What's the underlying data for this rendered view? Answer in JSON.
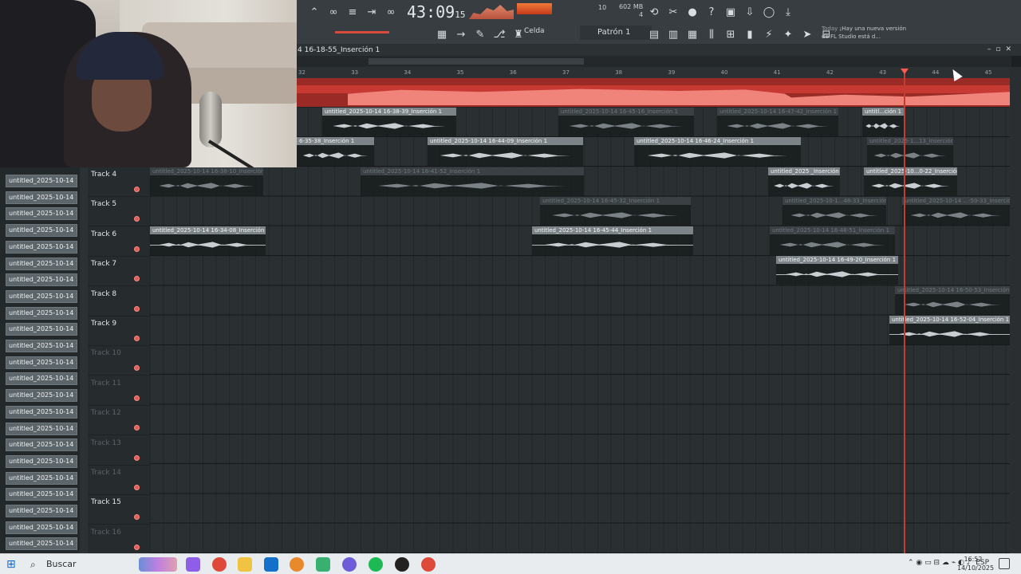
{
  "toolbar": {
    "time_main": "43:09",
    "time_sub": "15",
    "tempo_value": "10",
    "memory": "602 MB",
    "memory_sub": "4",
    "snap_label": "Celda",
    "pattern_label": "Patrón 1",
    "news_today": "Today",
    "news_text": "¡Hay una nueva versión de FL Studio está d..."
  },
  "breadcrumb": {
    "title": "4 16-18-55_Inserción 1"
  },
  "ruler": {
    "bars": [
      "32",
      "33",
      "34",
      "35",
      "36",
      "37",
      "38",
      "39",
      "40",
      "41",
      "42",
      "43",
      "44",
      "45"
    ]
  },
  "picker": {
    "items": [
      "untitled_2025-10-14 16-...",
      "untitled_2025-10-14 16-...",
      "untitled_2025-10-14 16-...",
      "untitled_2025-10-14 16-...",
      "untitled_2025-10-14 16-...",
      "untitled_2025-10-14 16-...",
      "untitled_2025-10-14 16-...",
      "untitled_2025-10-14 16-...",
      "untitled_2025-10-14 16-...",
      "untitled_2025-10-14 16-...",
      "untitled_2025-10-14 16-...",
      "untitled_2025-10-14 16-...",
      "untitled_2025-10-14 16-...",
      "untitled_2025-10-14 16-...",
      "untitled_2025-10-14 16-...",
      "untitled_2025-10-14 16-...",
      "untitled_2025-10-14 16-...",
      "untitled_2025-10-14 16-...",
      "untitled_2025-10-14 16-...",
      "untitled_2025-10-14 16-...",
      "untitled_2025-10-14 16-...",
      "untitled_2025-10-14 16-...",
      "untitled_2025-10-14 16-..."
    ]
  },
  "tracks": [
    "Track 4",
    "Track 5",
    "Track 6",
    "Track 7",
    "Track 8",
    "Track 9",
    "Track 10",
    "Track 11",
    "Track 12",
    "Track 13",
    "Track 14",
    "Track 15",
    "Track 16"
  ],
  "clips": {
    "r1a": "untitled_2025-10-14 16-38-39_Inserción 1",
    "r1b": "untitled_2025-10-14 16-45-16_Inserción 1",
    "r1c": "untitled_2025-10-14 16-47-42_Inserción 1",
    "r1d": "untitl...ción 1",
    "r2a": "6-35-38_Inserción 1",
    "r2b": "untitled_2025-10-14 16-44-09_Inserción 1",
    "r2c": "untitled_2025-10-14 16-46-24_Inserción 1",
    "r2d": "untitled_2025-1...13_Inserción 1",
    "t4a": "untitled_2025-10-14 16-38-10_Inserción 1",
    "t4b": "untitled_2025-10-14 16-41-52_Inserción 1",
    "t4c": "untitled_2025 _Inserción 1",
    "t4d": "untitled_2025-10...0-22_Inserción 1",
    "t5a": "untitled_2025-10-14 16-45-32_Inserción 1",
    "t5b": "untitled_2025-10-1...48-33_Inserción 1",
    "t5c": "untitled_2025-10-14 ...-50-33_Inserción 1",
    "t6a": "untitled_2025-10-14 16-34-08_Inserción 1",
    "t6b": "untitled_2025-10-14 16-45-44_Inserción 1",
    "t6c": "untitled_2025-10-14 16-48-51_Inserción 1",
    "t7a": "untitled_2025-10-14 16-49-20_Inserción 1",
    "t8a": "untitled_2025-10-14 16-50-53_Inserción 1",
    "t9a": "untitled_2025-10-14 16-52-04_Inserción 1"
  },
  "taskbar": {
    "search_placeholder": "Buscar",
    "lang": "ESP",
    "time": "16:52",
    "date": "14/10/2025"
  }
}
